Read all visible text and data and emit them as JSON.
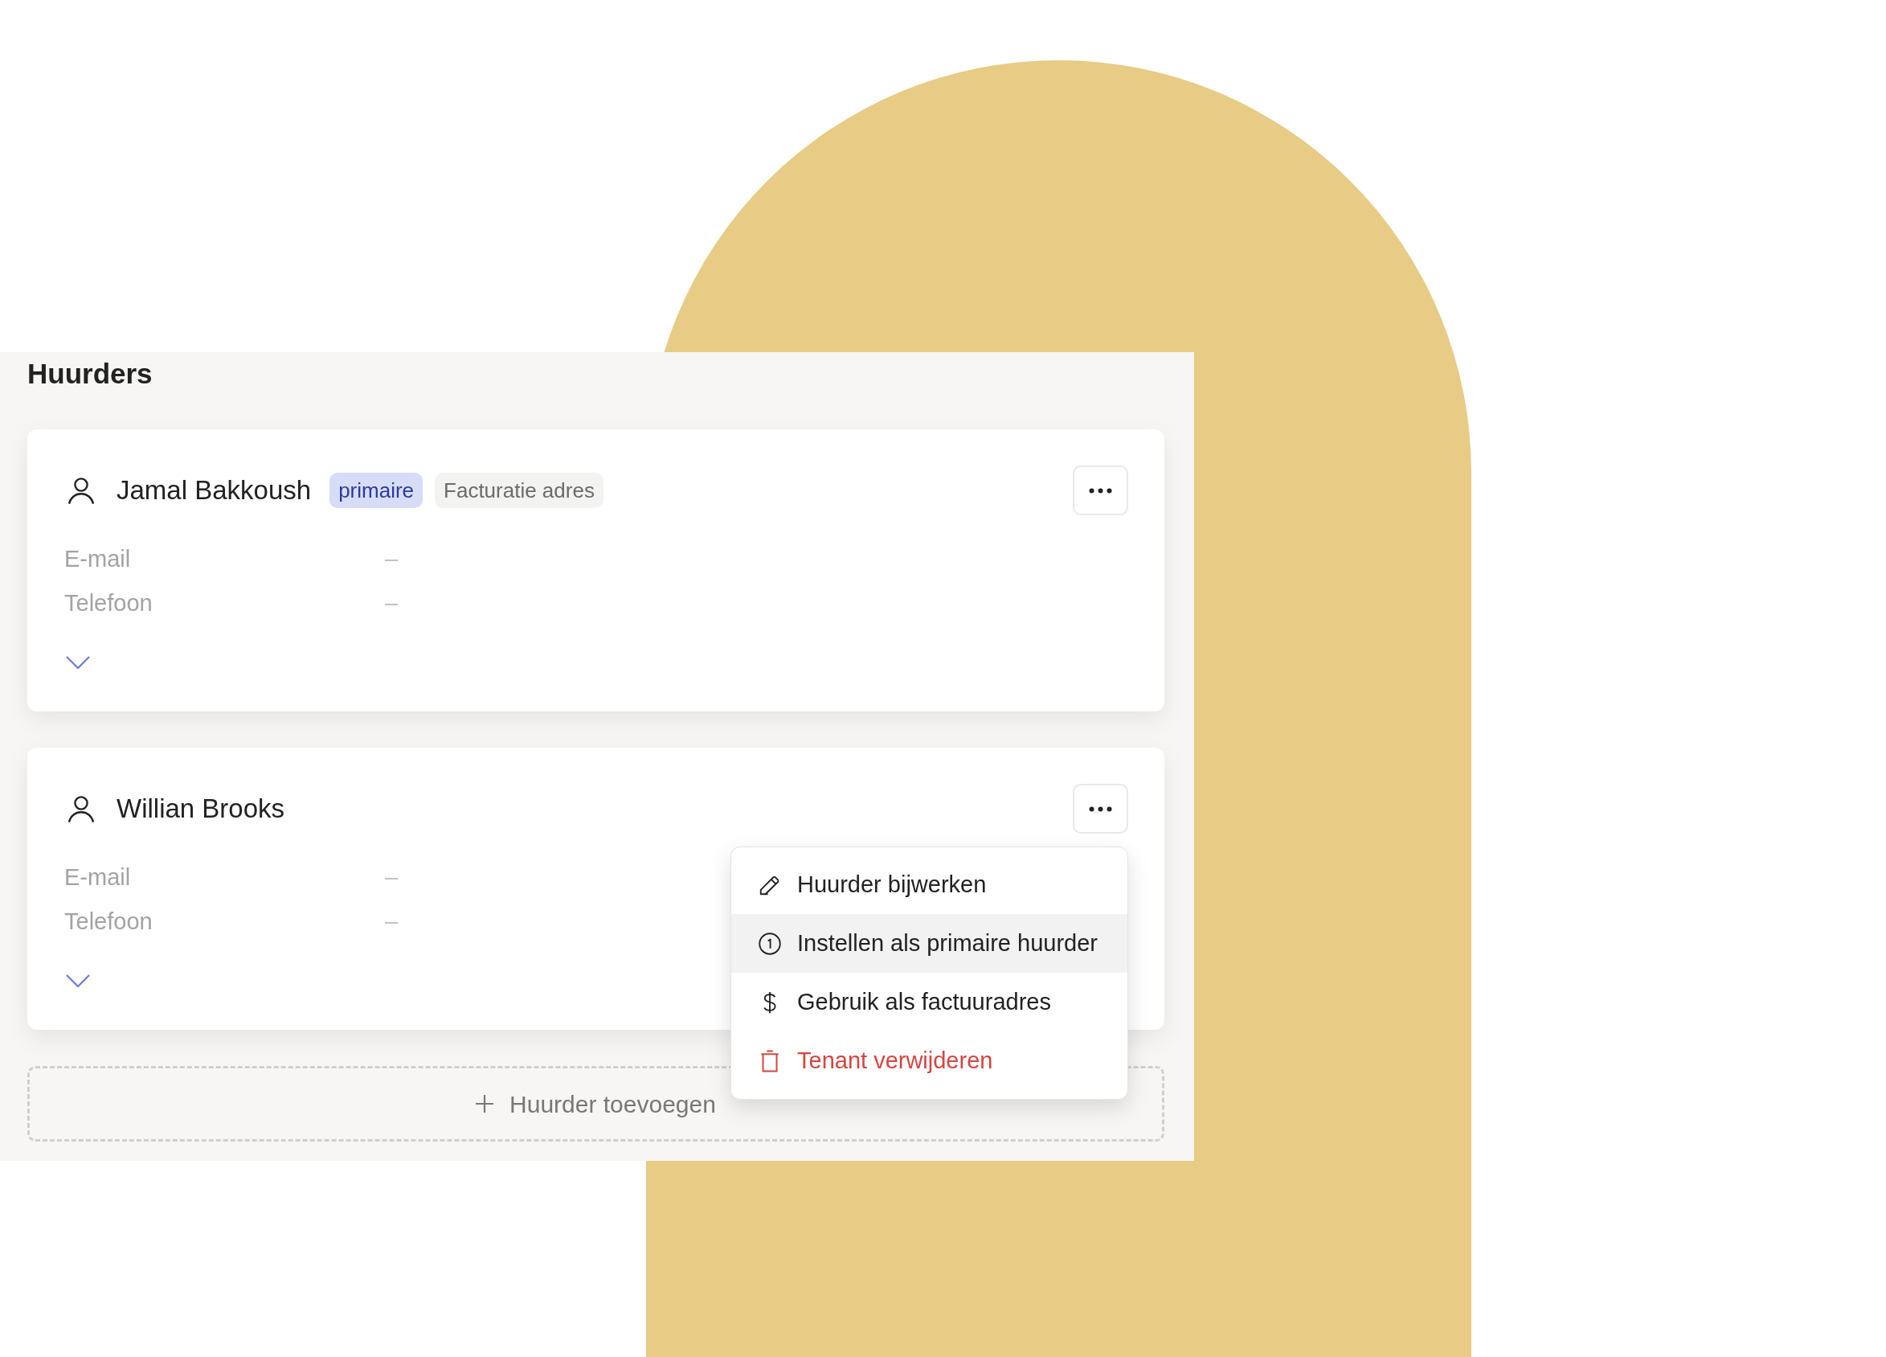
{
  "section": {
    "title": "Huurders"
  },
  "tenants": [
    {
      "name": "Jamal Bakkoush",
      "tags": [
        {
          "label": "primaire",
          "kind": "primary"
        },
        {
          "label": "Facturatie adres",
          "kind": "neutral"
        }
      ],
      "fields": [
        {
          "label": "E-mail",
          "value": "–"
        },
        {
          "label": "Telefoon",
          "value": "–"
        }
      ],
      "expanded": false
    },
    {
      "name": "Willian Brooks",
      "fields": [
        {
          "label": "E-mail",
          "value": "–"
        },
        {
          "label": "Telefoon",
          "value": "–"
        }
      ],
      "expanded": false,
      "menu": {
        "items": [
          {
            "label": "Huurder bijwerken",
            "kind": "default",
            "highlighted": false
          },
          {
            "label": "Instellen als primaire huurder",
            "kind": "default",
            "highlighted": true
          },
          {
            "label": "Gebruik als factuuradres",
            "kind": "default",
            "highlighted": false
          },
          {
            "label": "Tenant verwijderen",
            "kind": "danger",
            "highlighted": false
          }
        ]
      }
    }
  ],
  "add_button": {
    "label": "Huurder toevoegen"
  }
}
